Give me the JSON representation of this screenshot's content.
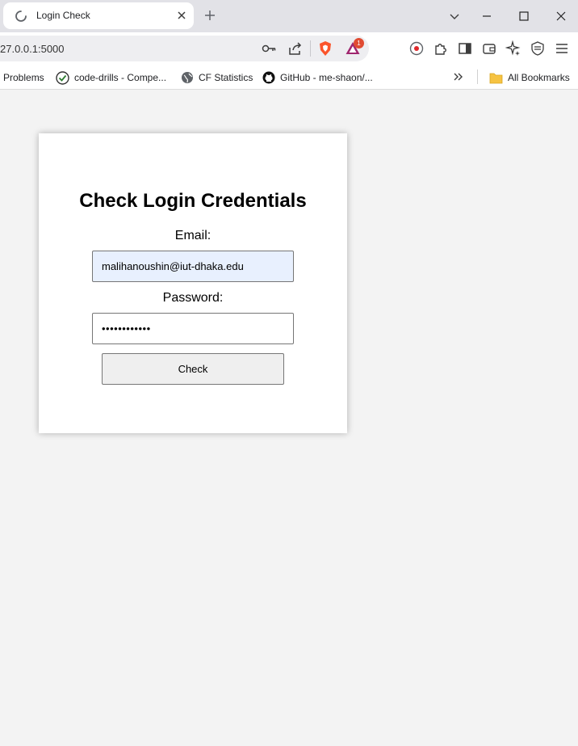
{
  "tab": {
    "title": "Login Check"
  },
  "toolbar": {
    "url": "27.0.0.1:5000",
    "brave_rewards_count": "1"
  },
  "bookmarks": {
    "items": [
      {
        "label": "Problems"
      },
      {
        "label": "code-drills - Compe..."
      },
      {
        "label": "CF Statistics"
      },
      {
        "label": "GitHub - me-shaon/..."
      }
    ],
    "all_bookmarks": "All Bookmarks"
  },
  "form": {
    "heading": "Check Login Credentials",
    "email_label": "Email:",
    "email_value": "malihanoushin@iut-dhaka.edu",
    "password_label": "Password:",
    "password_value": "••••••••••••",
    "button_label": "Check"
  },
  "colors": {
    "autofill_bg": "#e8f0fe",
    "page_bg": "#f3f3f3",
    "tabstrip_bg": "#e2e2e7",
    "brave_orange": "#fb542b"
  },
  "icons": [
    "loading-spinner-icon",
    "close-icon",
    "plus-icon",
    "chevron-down-icon",
    "minimize-icon",
    "maximize-icon",
    "key-icon",
    "share-icon",
    "brave-shield-icon",
    "brave-rewards-icon",
    "record-icon",
    "extensions-icon",
    "sidebar-icon",
    "wallet-icon",
    "leo-ai-icon",
    "vpn-icon",
    "menu-icon",
    "checkmark-circle-icon",
    "globe-icon",
    "github-icon",
    "double-chevron-icon",
    "folder-icon"
  ]
}
